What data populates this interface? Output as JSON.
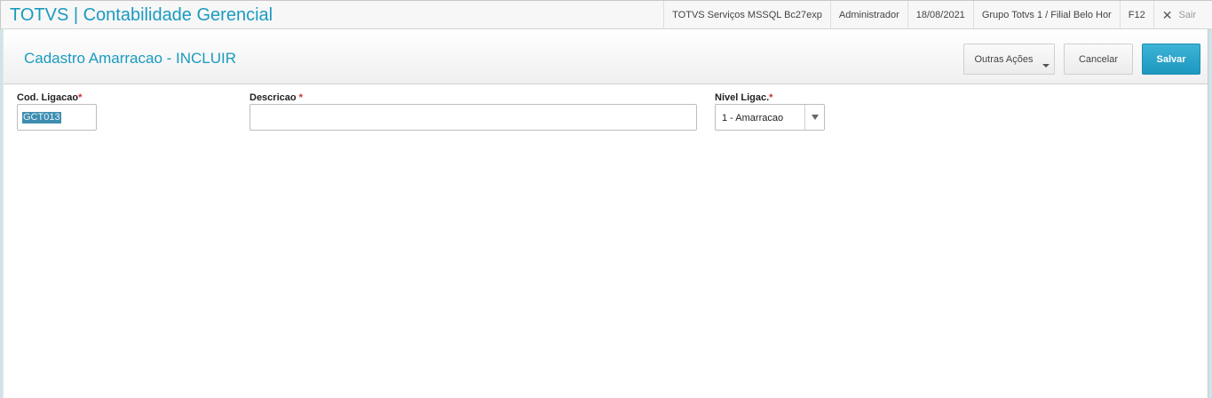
{
  "app": {
    "title": "TOTVS | Contabilidade Gerencial"
  },
  "topbar": {
    "server": "TOTVS Serviços MSSQL Bc27exp",
    "user": "Administrador",
    "date": "18/08/2021",
    "branch": "Grupo Totvs 1 / Filial Belo Hor",
    "help_key": "F12",
    "exit_label": "Sair"
  },
  "header": {
    "title": "Cadastro Amarracao - INCLUIR",
    "buttons": {
      "other_actions": "Outras Ações",
      "cancel": "Cancelar",
      "save": "Salvar"
    }
  },
  "form": {
    "cod_ligacao": {
      "label": "Cod. Ligacao",
      "required_mark": "*",
      "value": "GCT013"
    },
    "descricao": {
      "label": "Descricao ",
      "required_mark": "*",
      "value": ""
    },
    "nivel_ligac": {
      "label": "Nivel Ligac.",
      "required_mark": "*",
      "value": "1 - Amarracao"
    }
  },
  "colors": {
    "accent": "#1a9ac0",
    "save_button": "#1e97bf",
    "required": "#d0282b"
  }
}
